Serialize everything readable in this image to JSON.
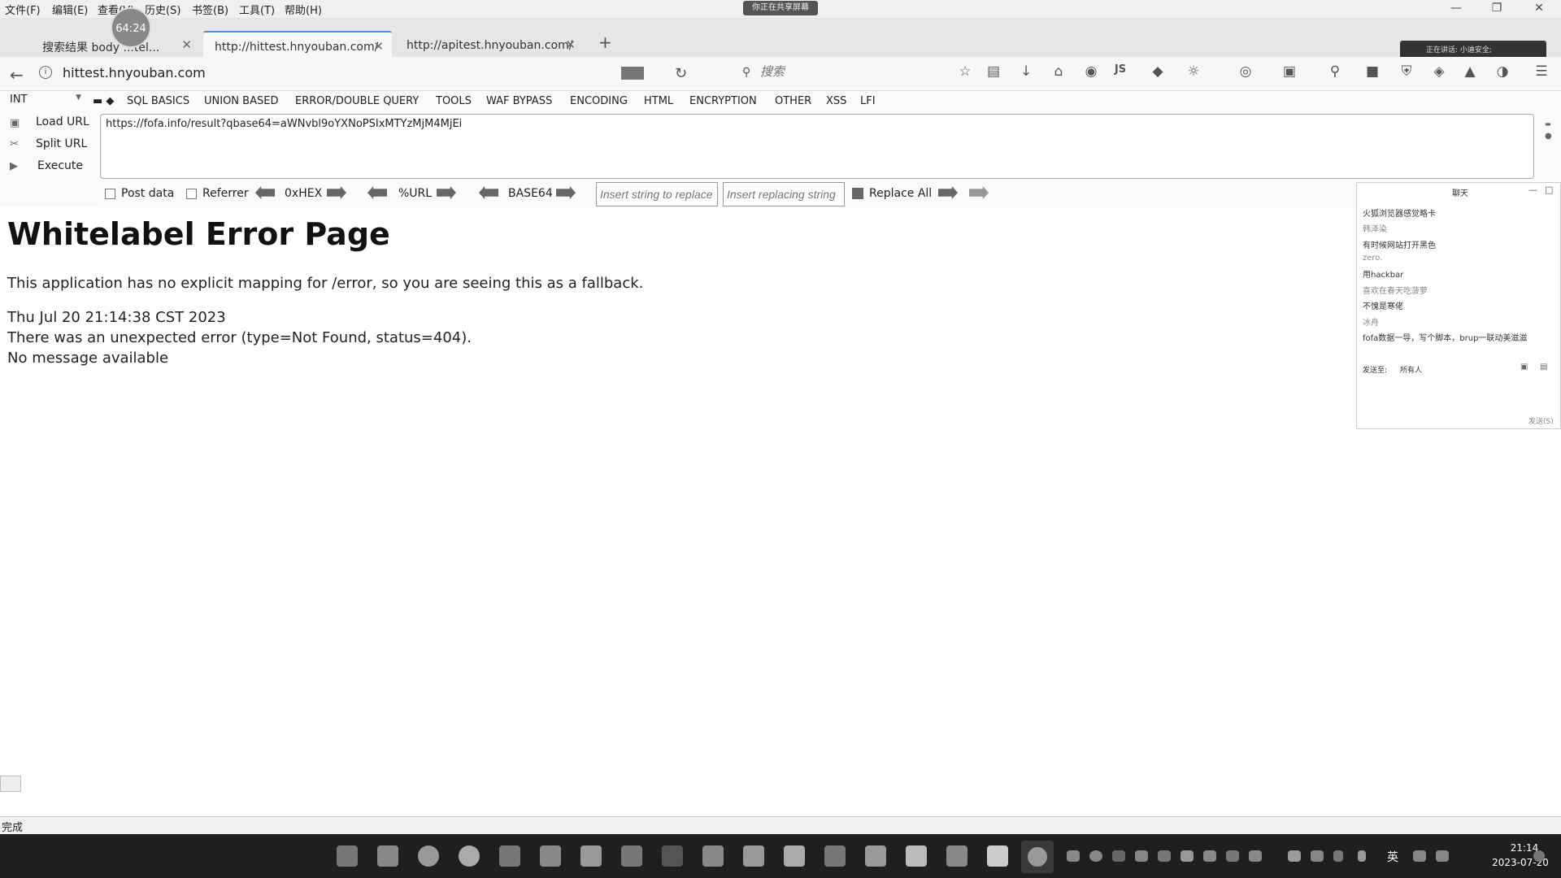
{
  "menu": [
    "文件(F)",
    "编辑(E)",
    "查看(V)",
    "历史(S)",
    "书签(B)",
    "工具(T)",
    "帮助(H)"
  ],
  "share_badge": "你正在共享屏幕",
  "timer": "64:24",
  "tabs": [
    {
      "label": "搜索结果 body ...tel..."
    },
    {
      "label": "http://hittest.hnyouban.com/"
    },
    {
      "label": "http://apitest.hnyouban.com/"
    }
  ],
  "speaking": "正在讲话: 小迪安全;",
  "nav": {
    "url": "hittest.hnyouban.com",
    "search_placeholder": "搜索"
  },
  "hackbar": {
    "type_select": "INT",
    "menus": [
      "SQL BASICS",
      "UNION BASED",
      "ERROR/DOUBLE QUERY",
      "TOOLS",
      "WAF BYPASS",
      "ENCODING",
      "HTML",
      "ENCRYPTION",
      "OTHER",
      "XSS",
      "LFI"
    ],
    "load_url": "Load URL",
    "split_url": "Split URL",
    "execute": "Execute",
    "url_value": "https://fofa.info/result?qbase64=aWNvbl9oYXNoPSIxMTYzMjM4MjEi",
    "post_data": "Post data",
    "referrer": "Referrer",
    "hex": "0xHEX",
    "urlenc": "%URL",
    "base64": "BASE64",
    "insert_replace_placeholder": "Insert string to replace",
    "insert_replacing_placeholder": "Insert replacing string",
    "replace_all": "Replace All"
  },
  "page": {
    "title": "Whitelabel Error Page",
    "line1": "This application has no explicit mapping for /error, so you are seeing this as a fallback.",
    "line2": "Thu Jul 20 21:14:38 CST 2023",
    "line3": "There was an unexpected error (type=Not Found, status=404).",
    "line4": "No message available"
  },
  "chat": {
    "title": "聊天",
    "messages": [
      {
        "text": "火狐浏览器感觉略卡"
      },
      {
        "text": "韩泽染"
      },
      {
        "text": "有时候网站打开黑色"
      },
      {
        "text": "zero."
      },
      {
        "text": "用hackbar"
      },
      {
        "text": "喜欢在春天吃菠萝"
      },
      {
        "text": "不愧是寒佬"
      },
      {
        "text": "冰舟"
      },
      {
        "text": "fofa数据一导，写个脚本，brup一联动美滋滋"
      }
    ],
    "send_to_label": "发送至:",
    "send_to_value": "所有人",
    "send_button": "发送(S)"
  },
  "status": "完成",
  "taskbar": {
    "time": "21:14",
    "date": "2023-07-20",
    "ime": "英"
  }
}
